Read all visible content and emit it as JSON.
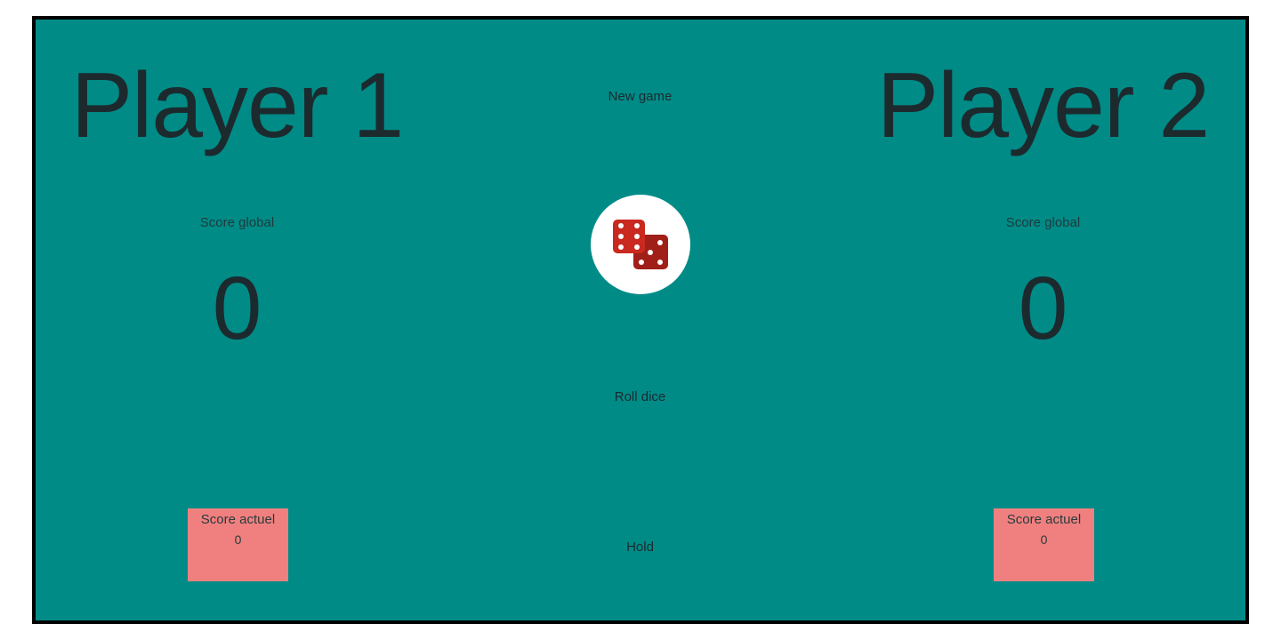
{
  "players": [
    {
      "name": "Player 1",
      "global_label": "Score global",
      "global_score": "0",
      "current_label": "Score actuel",
      "current_score": "0"
    },
    {
      "name": "Player 2",
      "global_label": "Score global",
      "global_score": "0",
      "current_label": "Score actuel",
      "current_score": "0"
    }
  ],
  "controls": {
    "new_game_label": "New game",
    "roll_label": "Roll dice",
    "hold_label": "Hold"
  },
  "dice_icon": "dice-icon",
  "colors": {
    "board": "#008b87",
    "current_box": "#f08080",
    "dice_front": "#c0281d",
    "dice_back": "#a01f18"
  }
}
